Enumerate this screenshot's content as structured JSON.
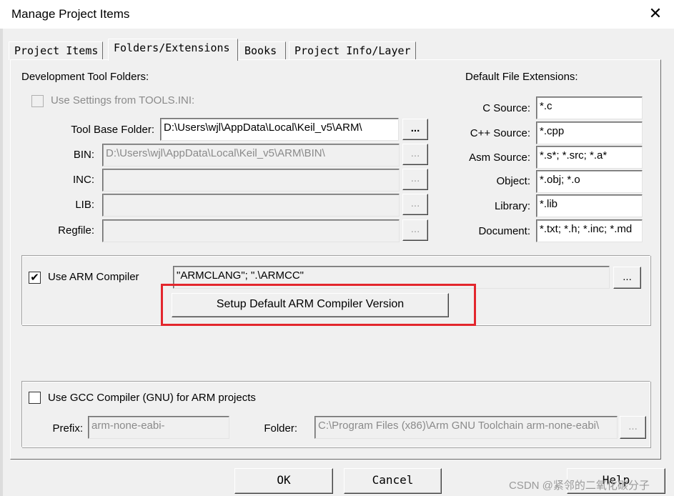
{
  "window": {
    "title": "Manage Project Items",
    "close_glyph": "✕"
  },
  "tabs": [
    {
      "label": "Project Items",
      "active": false
    },
    {
      "label": "Folders/Extensions",
      "active": true
    },
    {
      "label": "Books",
      "active": false
    },
    {
      "label": "Project Info/Layer",
      "active": false
    }
  ],
  "dev_folders": {
    "heading": "Development Tool Folders:",
    "use_tools_ini": {
      "label": "Use Settings from TOOLS.INI:",
      "checked": false,
      "enabled": false
    },
    "rows": [
      {
        "label": "Tool Base Folder:",
        "value": "D:\\Users\\wjl\\AppData\\Local\\Keil_v5\\ARM\\",
        "enabled": true
      },
      {
        "label": "BIN:",
        "value": "D:\\Users\\wjl\\AppData\\Local\\Keil_v5\\ARM\\BIN\\",
        "enabled": false
      },
      {
        "label": "INC:",
        "value": "",
        "enabled": false
      },
      {
        "label": "LIB:",
        "value": "",
        "enabled": false
      },
      {
        "label": "Regfile:",
        "value": "",
        "enabled": false
      }
    ],
    "browse_label": "..."
  },
  "extensions": {
    "heading": "Default File Extensions:",
    "rows": [
      {
        "label": "C Source:",
        "value": "*.c"
      },
      {
        "label": "C++ Source:",
        "value": "*.cpp"
      },
      {
        "label": "Asm Source:",
        "value": "*.s*; *.src; *.a*"
      },
      {
        "label": "Object:",
        "value": "*.obj; *.o"
      },
      {
        "label": "Library:",
        "value": "*.lib"
      },
      {
        "label": "Document:",
        "value": "*.txt; *.h; *.inc; *.md"
      }
    ]
  },
  "arm": {
    "checkbox_label": "Use ARM Compiler",
    "checked": true,
    "check_glyph": "✔",
    "value": "\"ARMCLANG\"; \".\\ARMCC\"",
    "browse_label": "...",
    "setup_button": "Setup Default ARM Compiler Version"
  },
  "gcc": {
    "checkbox_label": "Use GCC Compiler (GNU) for ARM projects",
    "checked": false,
    "prefix_label": "Prefix:",
    "prefix_value": "arm-none-eabi-",
    "folder_label": "Folder:",
    "folder_value": "C:\\Program Files (x86)\\Arm GNU Toolchain arm-none-eabi\\",
    "browse_label": "..."
  },
  "footer": {
    "ok": "OK",
    "cancel": "Cancel",
    "help": "Help"
  },
  "watermark": "CSDN @紧邻的二氧化碳分子",
  "colors": {
    "highlight": "#e3262d",
    "panel_bg": "#f0f0f0"
  }
}
